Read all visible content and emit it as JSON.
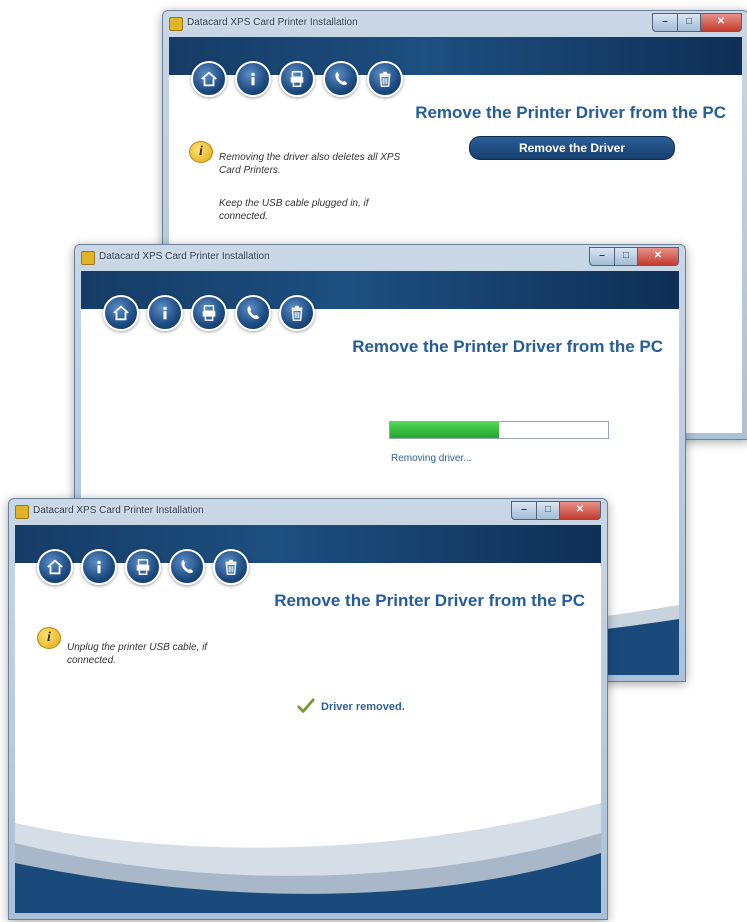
{
  "app": {
    "window_title": "Datacard XPS Card Printer Installation"
  },
  "window_controls": {
    "minimize": "–",
    "maximize": "□",
    "close": "✕"
  },
  "nav_icons": [
    "home-icon",
    "info-icon",
    "printer-icon",
    "phone-icon",
    "trash-icon"
  ],
  "heading": "Remove the Printer Driver from the PC",
  "screen1": {
    "note_line1": "Removing the driver also deletes all XPS Card Printers.",
    "note_line2": "Keep the USB cable plugged in, if connected.",
    "remove_button_label": "Remove the Driver"
  },
  "screen2": {
    "progress_fraction": 0.5,
    "status_text": "Removing driver..."
  },
  "screen3": {
    "note_text": "Unplug the printer USB cable, if connected.",
    "done_text": "Driver removed."
  },
  "colors": {
    "heading": "#245c9c",
    "banner": "#1d4f80",
    "progress": "#22a52c",
    "info_icon": "#e0a90e"
  }
}
